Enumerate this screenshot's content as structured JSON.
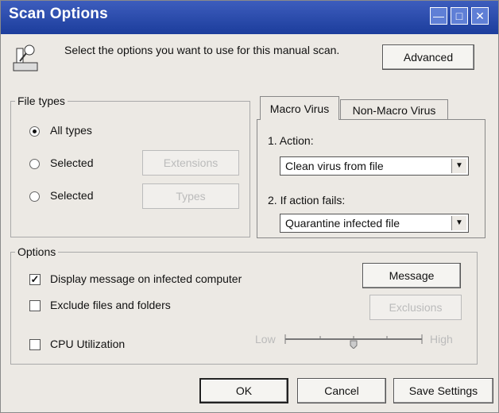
{
  "window": {
    "title": "Scan Options"
  },
  "header": {
    "instruction": "Select the options you want to use for this manual scan.",
    "advanced_label": "Advanced"
  },
  "file_types": {
    "legend": "File types",
    "options": [
      {
        "label": "All types",
        "selected": true
      },
      {
        "label": "Selected",
        "selected": false,
        "button": "Extensions"
      },
      {
        "label": "Selected",
        "selected": false,
        "button": "Types"
      }
    ]
  },
  "tabs": [
    {
      "label": "Macro Virus",
      "active": true
    },
    {
      "label": "Non-Macro Virus",
      "active": false
    }
  ],
  "actions": {
    "action_label": "1. Action:",
    "action_value": "Clean virus from file",
    "fail_label": "2. If action fails:",
    "fail_value": "Quarantine infected file"
  },
  "options": {
    "legend": "Options",
    "display_message": {
      "label": "Display message on infected computer",
      "checked": true
    },
    "message_button": "Message",
    "exclude": {
      "label": "Exclude files and folders",
      "checked": false
    },
    "exclusions_button": "Exclusions",
    "cpu": {
      "label": "CPU Utilization",
      "checked": false
    },
    "slider": {
      "low": "Low",
      "high": "High",
      "level": 0.5
    }
  },
  "footer": {
    "ok": "OK",
    "cancel": "Cancel",
    "save": "Save Settings"
  },
  "colors": {
    "title_bar": "#2a4aa8",
    "dialog_bg": "#ece9e4"
  }
}
